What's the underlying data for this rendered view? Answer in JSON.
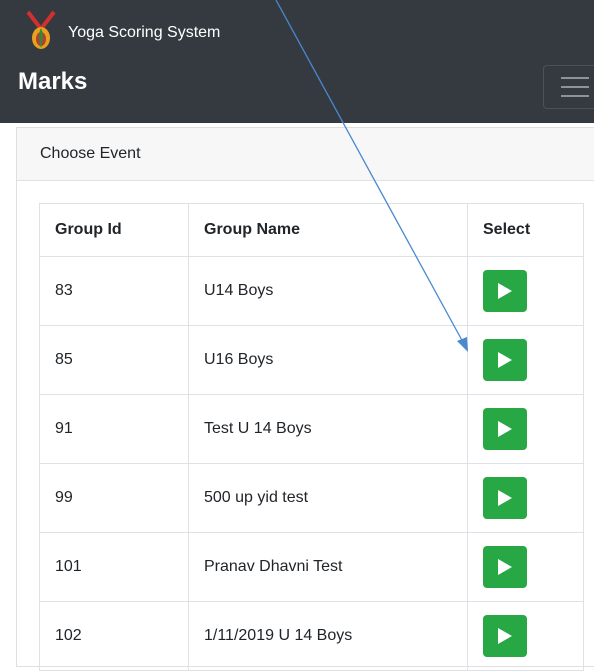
{
  "app": {
    "title": "Yoga Scoring System",
    "logo_text": "yoga"
  },
  "page": {
    "title": "Marks"
  },
  "card": {
    "header": "Choose Event"
  },
  "table": {
    "headers": {
      "id": "Group Id",
      "name": "Group Name",
      "select": "Select"
    },
    "rows": [
      {
        "id": "83",
        "name": "U14 Boys"
      },
      {
        "id": "85",
        "name": "U16 Boys"
      },
      {
        "id": "91",
        "name": "Test U 14 Boys"
      },
      {
        "id": "99",
        "name": "500 up yid test"
      },
      {
        "id": "101",
        "name": "Pranav Dhavni Test"
      },
      {
        "id": "102",
        "name": "1/11/2019 U 14 Boys"
      }
    ]
  },
  "icons": {
    "logo": "yoga-logo-icon",
    "menu": "hamburger-menu-icon",
    "select": "play-icon",
    "annotation": "arrow-annotation-icon"
  },
  "colors": {
    "navbar": "#343a40",
    "select_button": "#28a745",
    "annotation_arrow": "#4a88d0"
  }
}
